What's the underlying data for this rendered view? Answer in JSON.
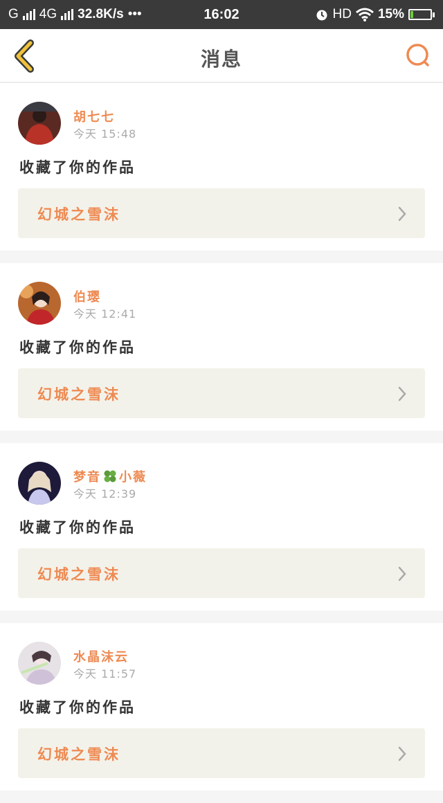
{
  "status_bar": {
    "carrier_left": "G",
    "network": "4G",
    "speed": "32.8K/s",
    "dots": "•••",
    "time": "16:02",
    "hd": "HD",
    "battery_percent": "15%",
    "battery_level": 0.15,
    "battery_color": "#6ccd3a"
  },
  "header": {
    "title": "消息",
    "back_icon": "chevron-left-icon",
    "search_icon": "search-icon"
  },
  "colors": {
    "accent": "#ee8a52",
    "back": "#f0c23a",
    "card_link_bg": "#f3f2ea"
  },
  "messages": [
    {
      "user": "胡七七",
      "time": "今天 15:48",
      "text": "收藏了你的作品",
      "work": "幻城之雪沫"
    },
    {
      "user": "伯璎",
      "time": "今天 12:41",
      "text": "收藏了你的作品",
      "work": "幻城之雪沫"
    },
    {
      "user_part1": "梦音",
      "user_part2": "小薇",
      "user_icon": "clover-icon",
      "time": "今天 12:39",
      "text": "收藏了你的作品",
      "work": "幻城之雪沫"
    },
    {
      "user": "水晶沫云",
      "time": "今天 11:57",
      "text": "收藏了你的作品",
      "work": "幻城之雪沫"
    }
  ]
}
